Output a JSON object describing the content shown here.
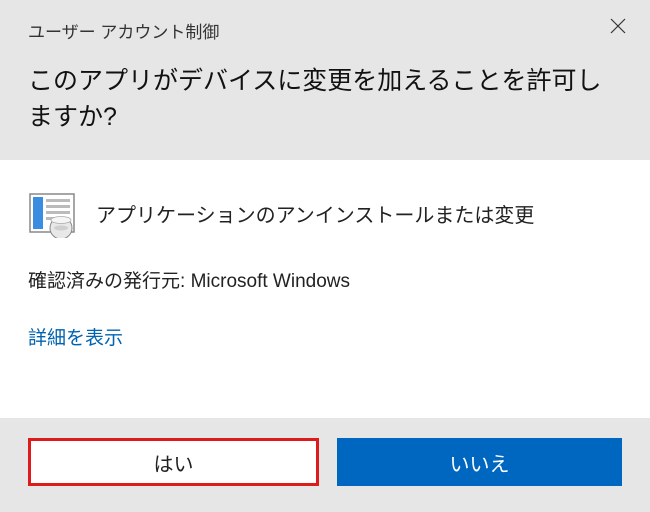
{
  "header": {
    "title": "ユーザー アカウント制御",
    "question": "このアプリがデバイスに変更を加えることを許可しますか?"
  },
  "body": {
    "app_name": "アプリケーションのアンインストールまたは変更",
    "publisher_label": "確認済みの発行元:",
    "publisher_name": "Microsoft Windows",
    "details_link": "詳細を表示"
  },
  "footer": {
    "yes_label": "はい",
    "no_label": "いいえ"
  },
  "colors": {
    "accent": "#0067c0",
    "highlight_border": "#dd1b1b",
    "header_bg": "#e6e6e6"
  }
}
